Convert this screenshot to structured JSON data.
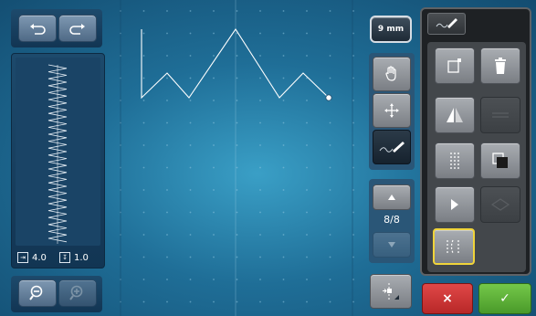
{
  "toolbar_left": {
    "undo_icon": "undo-arrow",
    "redo_icon": "redo-arrow"
  },
  "stitch_params": {
    "width_value": "4.0",
    "length_value": "1.0"
  },
  "zoom": {
    "zoom_out_icon": "magnifier-minus",
    "zoom_in_icon": "magnifier-plus"
  },
  "right_controls": {
    "grid_size_label": "9 mm",
    "page_indicator": "8/8"
  },
  "colors": {
    "accent_yellow": "#f0d43a",
    "cancel_red": "#d83a3a",
    "ok_green": "#5fb83a",
    "canvas_blue": "#2a89b4"
  }
}
